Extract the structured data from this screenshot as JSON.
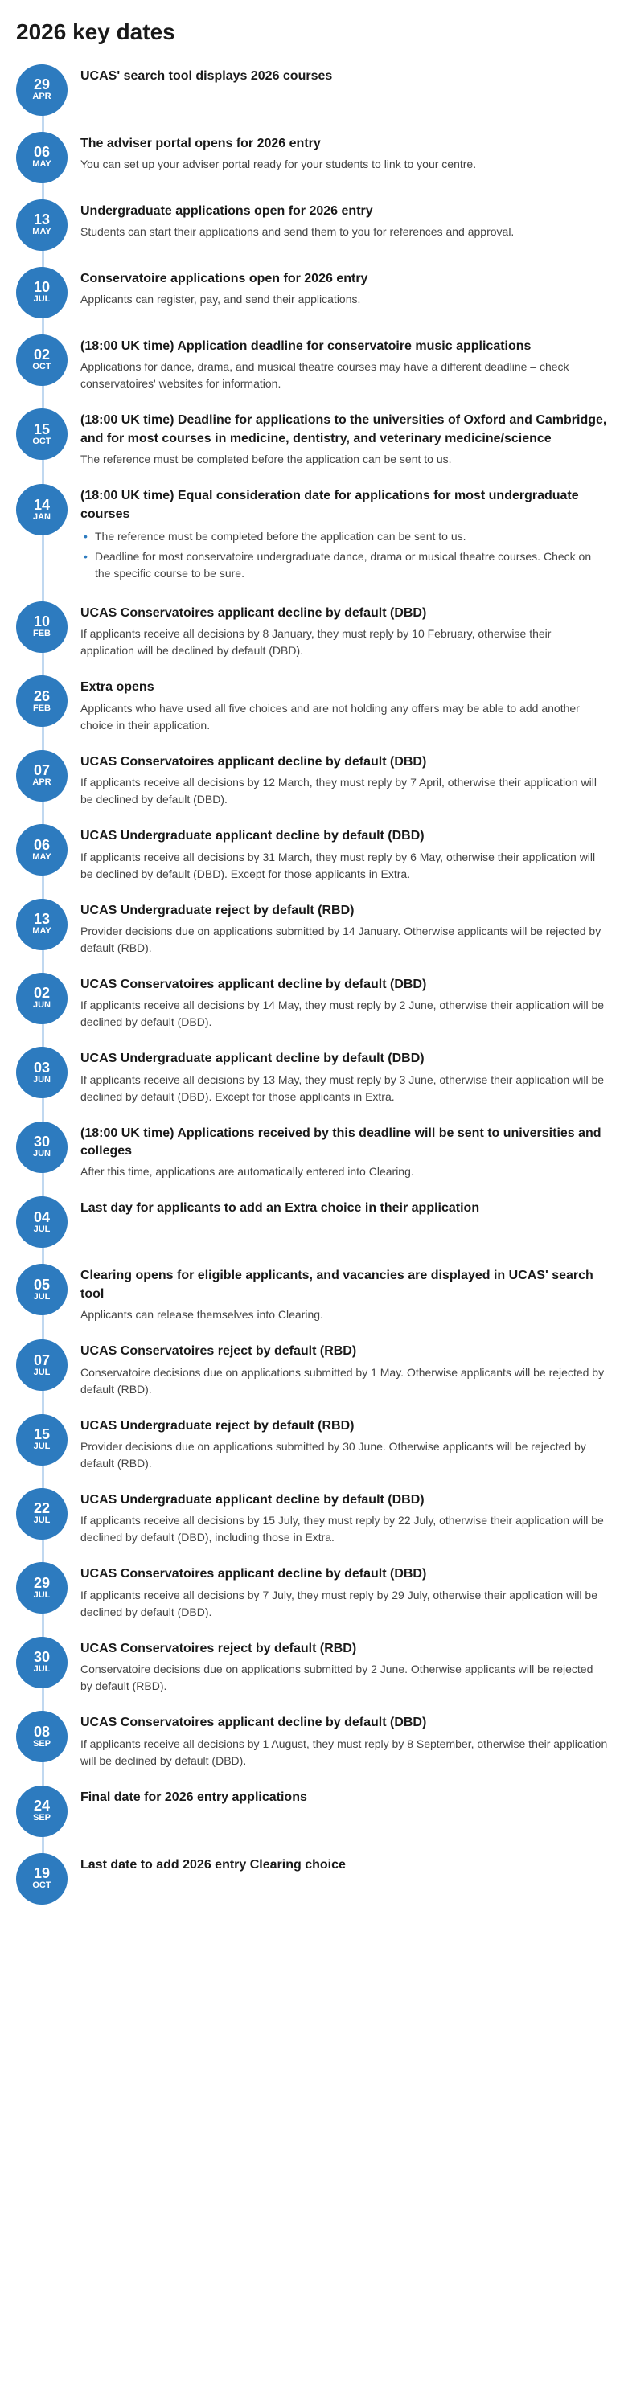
{
  "page": {
    "title": "2026 key dates"
  },
  "entries": [
    {
      "day": "29",
      "month": "APR",
      "title": "UCAS' search tool displays 2026 courses",
      "desc": "",
      "bullets": []
    },
    {
      "day": "06",
      "month": "MAY",
      "title": "The adviser portal opens for 2026 entry",
      "desc": "You can set up your adviser portal ready for your students to link to your centre.",
      "bullets": []
    },
    {
      "day": "13",
      "month": "MAY",
      "title": "Undergraduate applications open for 2026 entry",
      "desc": "Students can start their applications and send them to you for references and approval.",
      "bullets": []
    },
    {
      "day": "10",
      "month": "JUL",
      "title": "Conservatoire applications open for 2026 entry",
      "desc": "Applicants can register, pay, and send their applications.",
      "bullets": []
    },
    {
      "day": "02",
      "month": "OCT",
      "title": "(18:00 UK time) Application deadline for conservatoire music applications",
      "desc": "Applications for dance, drama, and musical theatre courses may have a different deadline – check conservatoires' websites for information.",
      "bullets": []
    },
    {
      "day": "15",
      "month": "OCT",
      "title": "(18:00 UK time) Deadline for applications to the universities of Oxford and Cambridge, and for most courses in medicine, dentistry, and veterinary medicine/science",
      "desc": "The reference must be completed before the application can be sent to us.",
      "bullets": []
    },
    {
      "day": "14",
      "month": "JAN",
      "title": "(18:00 UK time) Equal consideration date for applications for most undergraduate courses",
      "desc": "",
      "bullets": [
        "The reference must be completed before the application can be sent to us.",
        "Deadline for most conservatoire undergraduate dance, drama or musical theatre courses. Check on the specific course to be sure."
      ]
    },
    {
      "day": "10",
      "month": "FEB",
      "title": "UCAS Conservatoires applicant decline by default (DBD)",
      "desc": "If applicants receive all decisions by 8 January, they must reply by 10 February, otherwise their application will be declined by default (DBD).",
      "bullets": []
    },
    {
      "day": "26",
      "month": "FEB",
      "title": "Extra opens",
      "desc": "Applicants who have used all five choices and are not holding any offers may be able to add another choice in their application.",
      "bullets": []
    },
    {
      "day": "07",
      "month": "APR",
      "title": "UCAS Conservatoires applicant decline by default (DBD)",
      "desc": "If applicants receive all decisions by 12 March, they must reply by 7 April, otherwise their application will be declined by default (DBD).",
      "bullets": []
    },
    {
      "day": "06",
      "month": "MAY",
      "title": "UCAS Undergraduate applicant decline by default (DBD)",
      "desc": "If applicants receive all decisions by 31 March, they must reply by 6 May, otherwise their application will be declined by default (DBD). Except for those applicants in Extra.",
      "bullets": []
    },
    {
      "day": "13",
      "month": "MAY",
      "title": "UCAS Undergraduate reject by default (RBD)",
      "desc": "Provider decisions due on applications submitted by 14 January. Otherwise applicants will be rejected by default (RBD).",
      "bullets": []
    },
    {
      "day": "02",
      "month": "JUN",
      "title": "UCAS Conservatoires applicant decline by default (DBD)",
      "desc": "If applicants receive all decisions by 14 May, they must reply by 2 June, otherwise their application will be declined by default (DBD).",
      "bullets": []
    },
    {
      "day": "03",
      "month": "JUN",
      "title": "UCAS Undergraduate applicant decline by default (DBD)",
      "desc": "If applicants receive all decisions by 13 May, they must reply by 3 June, otherwise their application will be declined by default (DBD). Except for those applicants in Extra.",
      "bullets": []
    },
    {
      "day": "30",
      "month": "JUN",
      "title": "(18:00 UK time) Applications received by this deadline will be sent to universities and colleges",
      "desc": "After this time, applications are automatically entered into Clearing.",
      "bullets": []
    },
    {
      "day": "04",
      "month": "JUL",
      "title": "Last day for applicants to add an Extra choice in their application",
      "desc": "",
      "bullets": []
    },
    {
      "day": "05",
      "month": "JUL",
      "title": "Clearing opens for eligible applicants, and vacancies are displayed in UCAS' search tool",
      "desc": "Applicants can release themselves into Clearing.",
      "bullets": []
    },
    {
      "day": "07",
      "month": "JUL",
      "title": "UCAS Conservatoires reject by default (RBD)",
      "desc": "Conservatoire decisions due on applications submitted by 1 May. Otherwise applicants will be rejected by default (RBD).",
      "bullets": []
    },
    {
      "day": "15",
      "month": "JUL",
      "title": "UCAS Undergraduate reject by default (RBD)",
      "desc": "Provider decisions due on applications submitted by 30 June. Otherwise applicants will be rejected by default (RBD).",
      "bullets": []
    },
    {
      "day": "22",
      "month": "JUL",
      "title": "UCAS Undergraduate applicant decline by default (DBD)",
      "desc": "If applicants receive all decisions by 15 July, they must reply by 22 July, otherwise their application will be declined by default (DBD), including those in Extra.",
      "bullets": []
    },
    {
      "day": "29",
      "month": "JUL",
      "title": "UCAS Conservatoires applicant decline by default (DBD)",
      "desc": "If applicants receive all decisions by 7 July, they must reply by 29 July, otherwise their application will be declined by default (DBD).",
      "bullets": []
    },
    {
      "day": "30",
      "month": "JUL",
      "title": "UCAS Conservatoires reject by default (RBD)",
      "desc": "Conservatoire decisions due on applications submitted by 2 June. Otherwise applicants will be rejected by default (RBD).",
      "bullets": []
    },
    {
      "day": "08",
      "month": "SEP",
      "title": "UCAS Conservatoires applicant decline by default (DBD)",
      "desc": "If applicants receive all decisions by 1 August, they must reply by 8 September, otherwise their application will be declined by default (DBD).",
      "bullets": []
    },
    {
      "day": "24",
      "month": "SEP",
      "title": "Final date for 2026 entry applications",
      "desc": "",
      "bullets": []
    },
    {
      "day": "19",
      "month": "OCT",
      "title": "Last date to add 2026 entry Clearing choice",
      "desc": "",
      "bullets": []
    }
  ]
}
